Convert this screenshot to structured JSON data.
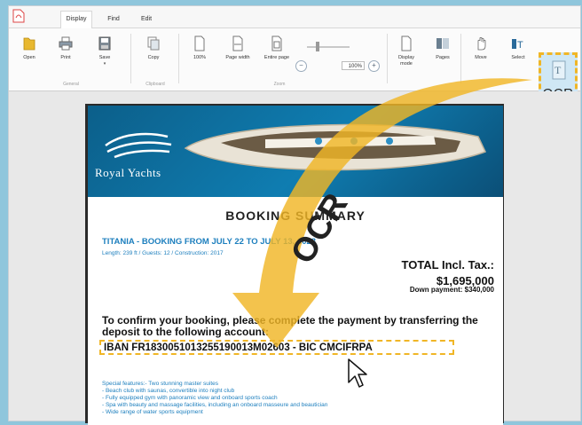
{
  "tabs": [
    {
      "label": "Display",
      "active": true
    },
    {
      "label": "Find",
      "active": false
    },
    {
      "label": "Edit",
      "active": false
    }
  ],
  "ribbon": {
    "buttons": {
      "open": "Open",
      "print": "Print",
      "save": "Save",
      "copy": "Copy",
      "zoom100": "100%",
      "page_width": "Page width",
      "entire_page": "Entire page",
      "display_mode": "Display mode",
      "pages": "Pages",
      "move": "Move",
      "select": "Select",
      "ocr": "OCR"
    },
    "zoom_value": "100%",
    "groups": {
      "general": "General",
      "clipboard": "Clipboard",
      "zoom": "Zoom"
    }
  },
  "document": {
    "brand": "Royal Yachts",
    "title": "BOOKING SUMMARY",
    "subtitle": "TITANIA - BOOKING FROM JULY 22 TO JULY 13, 2023",
    "specs": "Length: 239 ft / Guests: 12 / Construction: 2017",
    "total_label": "TOTAL Incl. Tax.:",
    "total_value": "$1,695,000",
    "down_payment": "Down payment: $340,000",
    "confirm_text": "To confirm your booking, please complete the payment by transferring the deposit to the following account:",
    "iban": "IBAN FR1830051013255190013M02603 - BIC CMCIFRPA",
    "features_title": "Special features:- Two stunning master suites",
    "features": [
      "- Beach club with saunas, convertible into night club",
      "- Fully equipped gym with panoramic view and onboard sports coach",
      "- Spa with beauty and massage facilities, including an onboard masseure and beautician",
      "- Wide range of water sports equipment"
    ]
  },
  "overlay": {
    "arrow_label": "OCR",
    "accent_color": "#f0b626"
  }
}
